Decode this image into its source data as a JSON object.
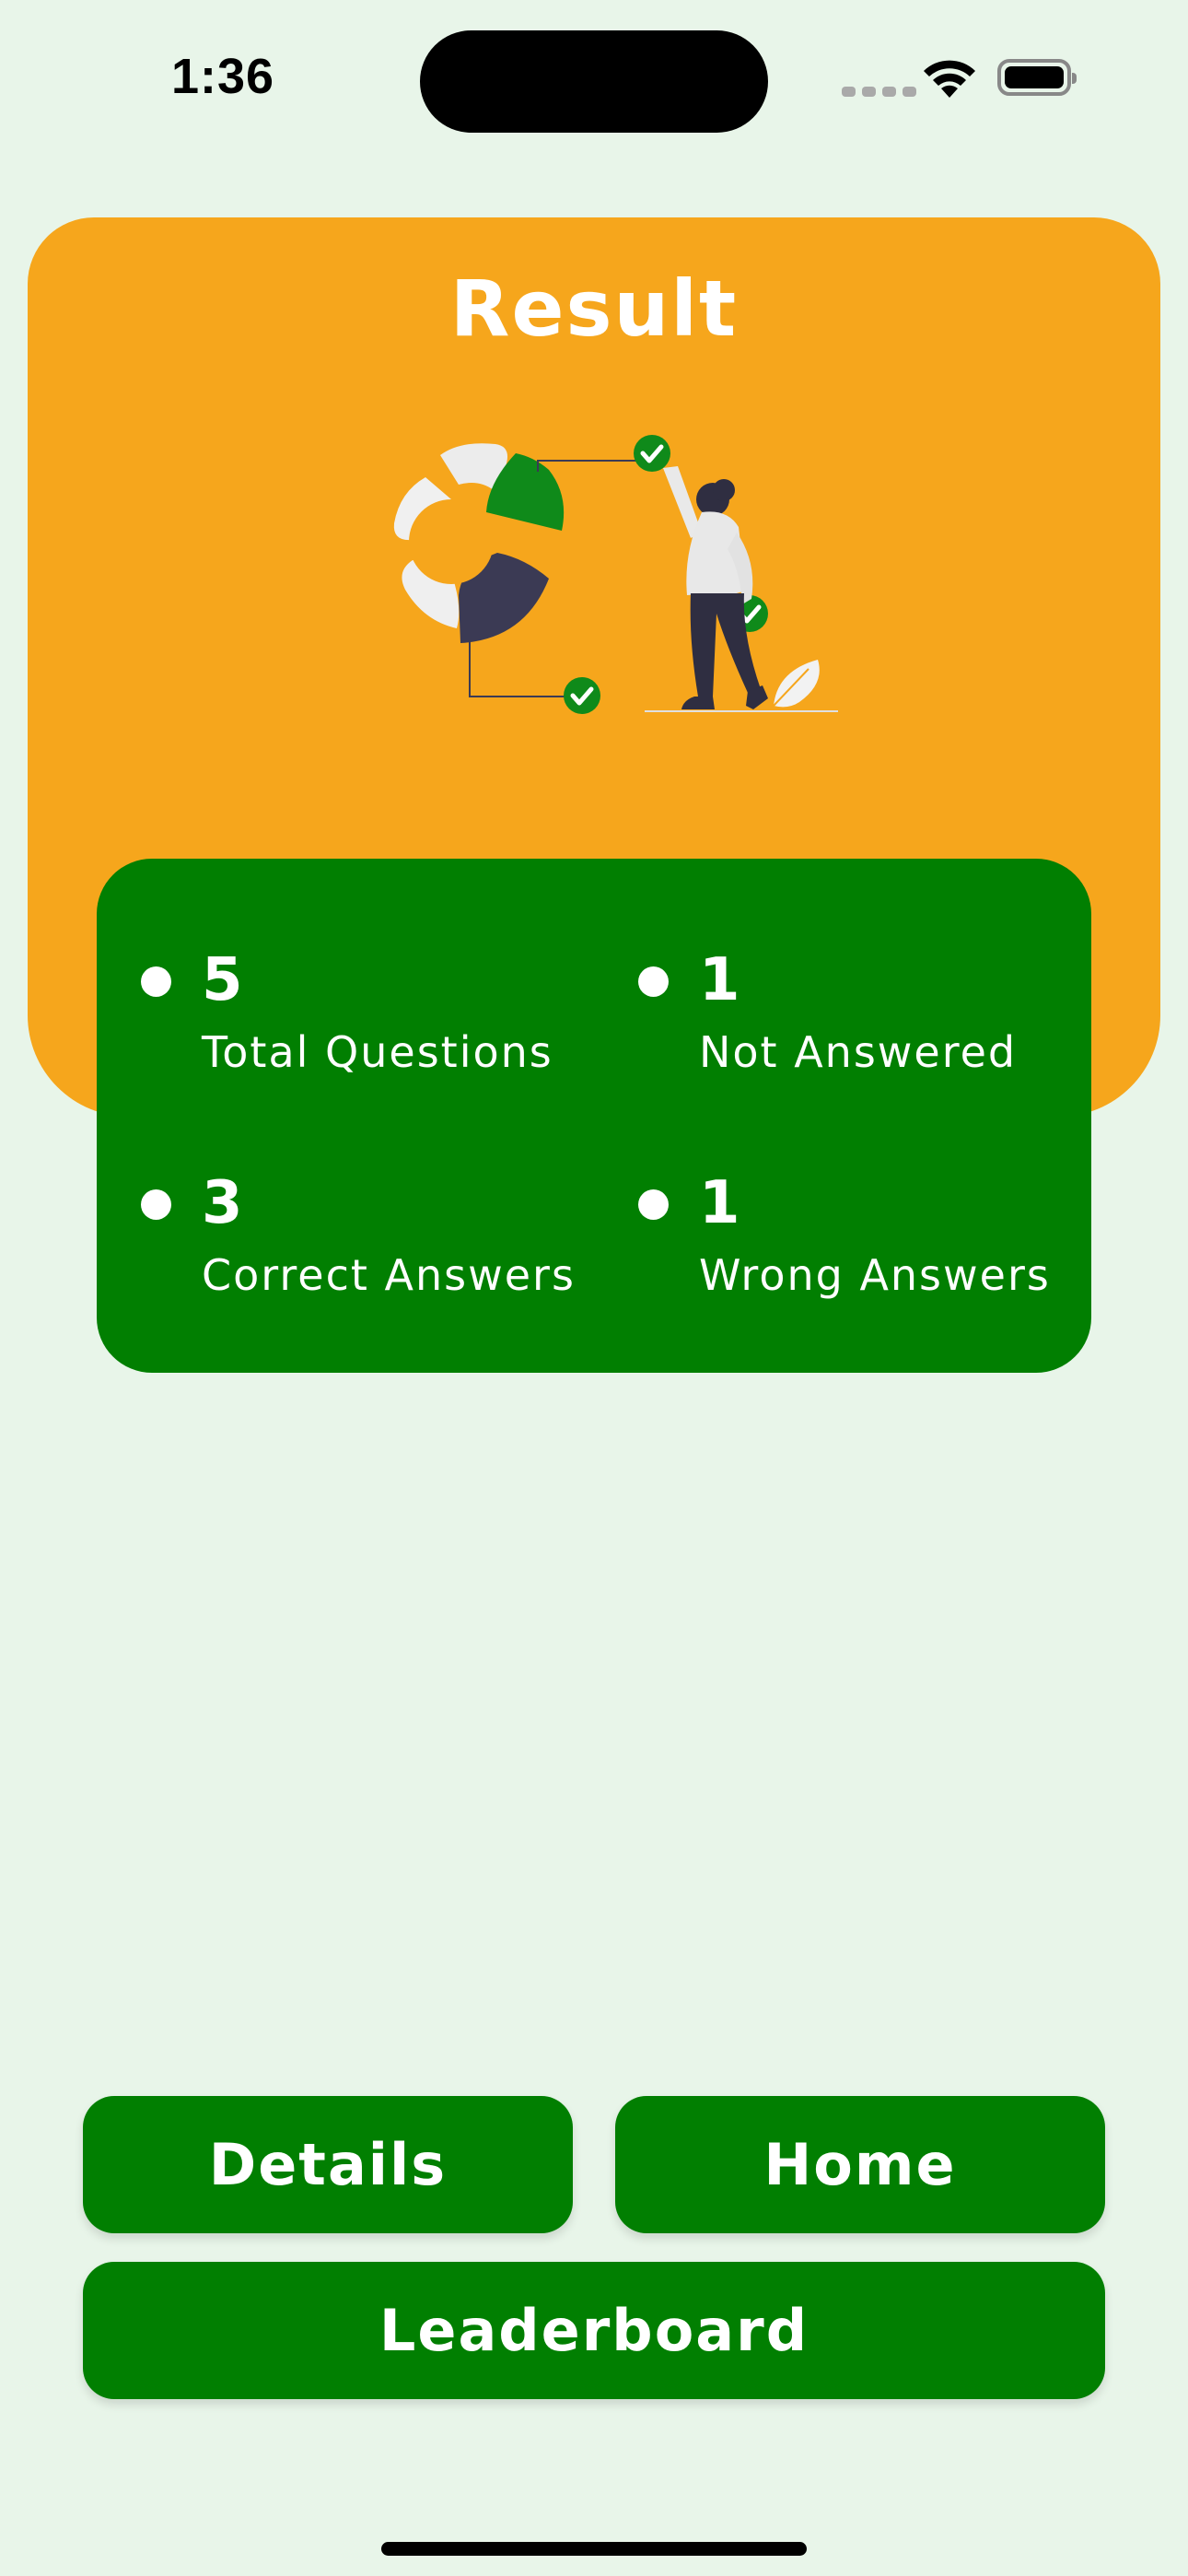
{
  "status_bar": {
    "time": "1:36",
    "icons": [
      "cellular-signal-icon",
      "wifi-icon",
      "battery-icon"
    ]
  },
  "result": {
    "title": "Result",
    "illustration": "person-checking-pie-chart-illustration"
  },
  "stats": [
    {
      "value": "5",
      "label": "Total Questions"
    },
    {
      "value": "1",
      "label": "Not Answered"
    },
    {
      "value": "3",
      "label": "Correct Answers"
    },
    {
      "value": "1",
      "label": "Wrong Answers"
    }
  ],
  "buttons": {
    "details": "Details",
    "home": "Home",
    "leaderboard": "Leaderboard"
  },
  "colors": {
    "background": "#e8f5e9",
    "card": "#f6a61c",
    "primary_green": "#017f01",
    "text_on_color": "#ffffff"
  }
}
